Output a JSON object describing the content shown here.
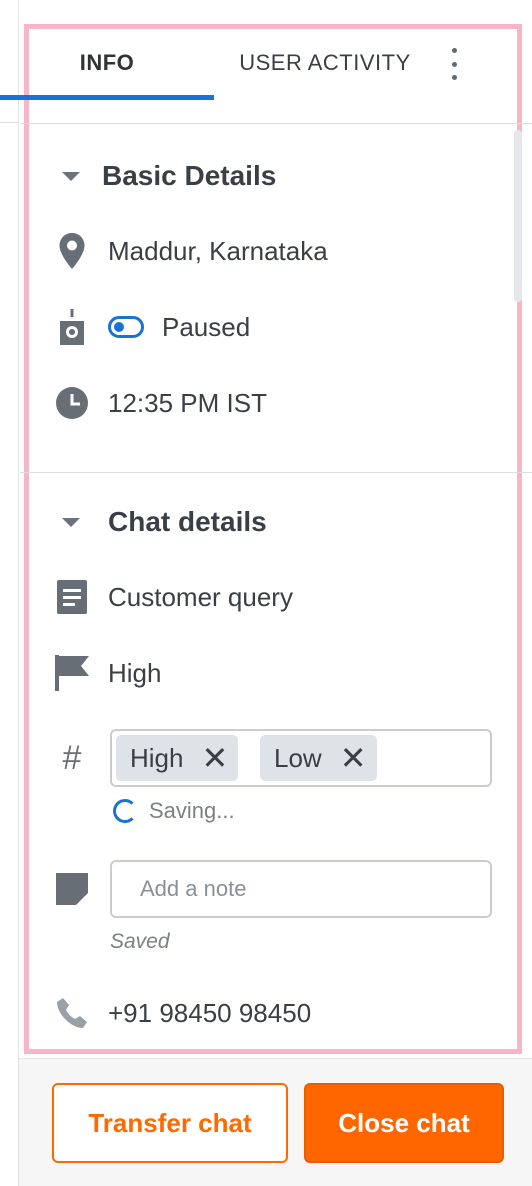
{
  "tabs": [
    {
      "label": "INFO",
      "active": true
    },
    {
      "label": "USER ACTIVITY",
      "active": false
    }
  ],
  "basic_details": {
    "title": "Basic Details",
    "location": "Maddur, Karnataka",
    "status": "Paused",
    "time": "12:35 PM IST"
  },
  "chat_details": {
    "title": "Chat details",
    "category": "Customer query",
    "priority": "High",
    "tags": [
      {
        "label": "High"
      },
      {
        "label": "Low"
      }
    ],
    "tag_remove_glyph": "✕",
    "saving_text": "Saving...",
    "note_placeholder": "Add a note",
    "note_value": "",
    "saved_text": "Saved",
    "phone": "+91 98450 98450"
  },
  "footer": {
    "transfer_label": "Transfer chat",
    "close_label": "Close chat"
  },
  "colors": {
    "accent_blue": "#1a73d4",
    "primary_orange": "#ff6600",
    "panel_highlight": "#f6b6c8"
  },
  "icons": {
    "location": "location-pin-icon",
    "status": "bot-status-icon",
    "time": "clock-icon",
    "category": "document-icon",
    "priority": "flag-icon",
    "tags": "hash-icon",
    "note": "sticky-note-icon",
    "phone": "phone-icon",
    "more": "more-vertical-icon"
  }
}
